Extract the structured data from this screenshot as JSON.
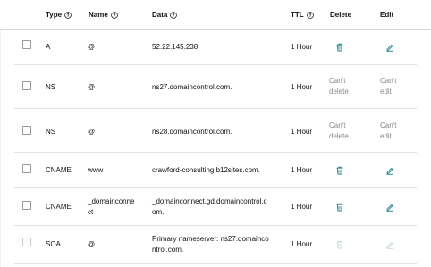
{
  "header": {
    "type": "Type",
    "name": "Name",
    "data": "Data",
    "ttl": "TTL",
    "delete": "Delete",
    "edit": "Edit"
  },
  "rows": [
    {
      "type": "A",
      "name": "@",
      "data": "52.22.145.238",
      "ttl": "1 Hour",
      "delete": "icon",
      "edit": "icon"
    },
    {
      "type": "NS",
      "name": "@",
      "data": "ns27.domaincontrol.com.",
      "ttl": "1 Hour",
      "delete_text_1": "Can't",
      "delete_text_2": "delete",
      "edit_text_1": "Can't",
      "edit_text_2": "edit"
    },
    {
      "type": "NS",
      "name": "@",
      "data": "ns28.domaincontrol.com.",
      "ttl": "1 Hour",
      "delete_text_1": "Can't",
      "delete_text_2": "delete",
      "edit_text_1": "Can't",
      "edit_text_2": "edit"
    },
    {
      "type": "CNAME",
      "name": "www",
      "data": "crawford-consulting.b12sites.com.",
      "ttl": "1 Hour",
      "delete": "icon",
      "edit": "icon"
    },
    {
      "type": "CNAME",
      "name_1": "_domainconne",
      "name_2": "ct",
      "data_1": "_domainconnect.gd.domaincontrol.c",
      "data_2": "om.",
      "ttl": "1 Hour",
      "delete": "icon",
      "edit": "icon"
    },
    {
      "type": "SOA",
      "name": "@",
      "data_1": "Primary nameserver: ns27.domainco",
      "data_2": "ntrol.com.",
      "ttl": "1 Hour",
      "delete": "icon-disabled",
      "edit": "icon-disabled"
    }
  ],
  "icons": {
    "info": "info-icon",
    "delete": "trash-icon",
    "edit": "pencil-icon"
  },
  "colors": {
    "accent": "#1a7f8f",
    "disabled": "#c9d9d9",
    "muted_text": "#888888"
  }
}
